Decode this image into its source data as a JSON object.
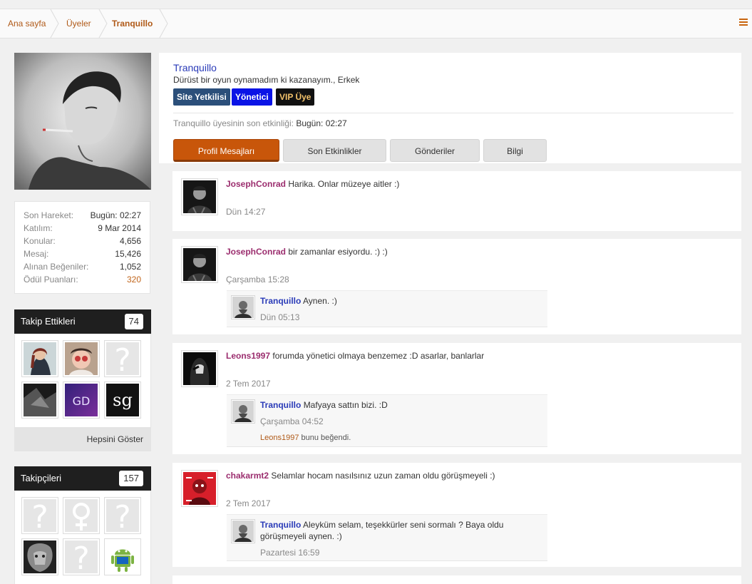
{
  "breadcrumb": [
    "Ana sayfa",
    "Üyeler",
    "Tranquillo"
  ],
  "stats": {
    "last_action_label": "Son Hareket:",
    "last_action_value": "Bugün: 02:27",
    "joined_label": "Katılım:",
    "joined_value": "9 Mar 2014",
    "threads_label": "Konular:",
    "threads_value": "4,656",
    "messages_label": "Mesaj:",
    "messages_value": "15,426",
    "likes_label": "Alınan Beğeniler:",
    "likes_value": "1,052",
    "points_label": "Ödül Puanları:",
    "points_value": "320"
  },
  "following": {
    "title": "Takip Ettikleri",
    "count": "74",
    "show_all": "Hepsini Göster"
  },
  "followers": {
    "title": "Takipçileri",
    "count": "157"
  },
  "profile": {
    "username": "Tranquillo",
    "tagline": "Dürüst bir oyun oynamadım ki kazanayım., Erkek",
    "badges": [
      "Site Yetkilisi",
      "Yönetici",
      "VIP Üye"
    ],
    "last_activity_prefix": "Tranquillo üyesinin son etkinliği:",
    "last_activity_value": "Bugün: 02:27",
    "tabs": [
      "Profil Mesajları",
      "Son Etkinlikler",
      "Gönderiler",
      "Bilgi"
    ]
  },
  "posts": [
    {
      "author": "JosephConrad",
      "text": "Harika. Onlar müzeye aitler :)",
      "date": "Dün 14:27"
    },
    {
      "author": "JosephConrad",
      "text": "bir zamanlar esiyordu. :) :)",
      "date": "Çarşamba 15:28",
      "reply": {
        "author": "Tranquillo",
        "text": "Aynen. :)",
        "date": "Dün 05:13"
      }
    },
    {
      "author": "Leons1997",
      "text": "forumda yönetici olmaya benzemez :D asarlar, banlarlar",
      "date": "2 Tem 2017",
      "reply": {
        "author": "Tranquillo",
        "text": "Mafyaya sattın bizi. :D",
        "date": "Çarşamba 04:52",
        "like_user": "Leons1997",
        "like_text": "bunu beğendi."
      }
    },
    {
      "author": "chakarmt2",
      "text": "Selamlar hocam nasılsınız uzun zaman oldu görüşmeyeli :)",
      "date": "2 Tem 2017",
      "reply": {
        "author": "Tranquillo",
        "text": "Aleyküm selam, teşekkürler seni sormalı ? Baya oldu",
        "text2": "görüşmeyeli aynen. :)",
        "date": "Pazartesi 16:59"
      }
    }
  ],
  "colors": {
    "accent": "#c8560a",
    "username_blue": "#2a3bb8",
    "author_purple": "#9b2d6e"
  }
}
